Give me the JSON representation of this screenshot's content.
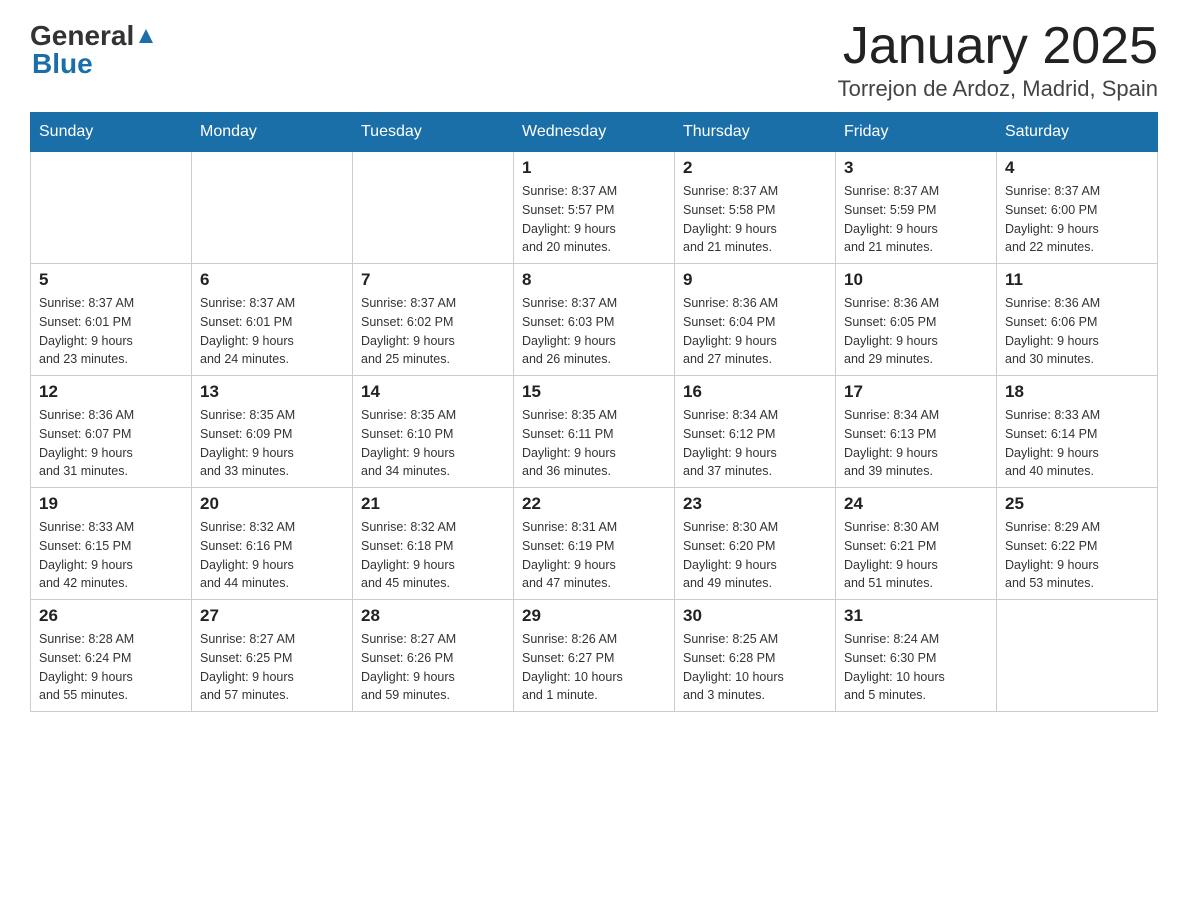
{
  "header": {
    "logo_general": "General",
    "logo_blue": "Blue",
    "month_title": "January 2025",
    "location": "Torrejon de Ardoz, Madrid, Spain"
  },
  "weekdays": [
    "Sunday",
    "Monday",
    "Tuesday",
    "Wednesday",
    "Thursday",
    "Friday",
    "Saturday"
  ],
  "weeks": [
    [
      {
        "day": "",
        "info": ""
      },
      {
        "day": "",
        "info": ""
      },
      {
        "day": "",
        "info": ""
      },
      {
        "day": "1",
        "info": "Sunrise: 8:37 AM\nSunset: 5:57 PM\nDaylight: 9 hours\nand 20 minutes."
      },
      {
        "day": "2",
        "info": "Sunrise: 8:37 AM\nSunset: 5:58 PM\nDaylight: 9 hours\nand 21 minutes."
      },
      {
        "day": "3",
        "info": "Sunrise: 8:37 AM\nSunset: 5:59 PM\nDaylight: 9 hours\nand 21 minutes."
      },
      {
        "day": "4",
        "info": "Sunrise: 8:37 AM\nSunset: 6:00 PM\nDaylight: 9 hours\nand 22 minutes."
      }
    ],
    [
      {
        "day": "5",
        "info": "Sunrise: 8:37 AM\nSunset: 6:01 PM\nDaylight: 9 hours\nand 23 minutes."
      },
      {
        "day": "6",
        "info": "Sunrise: 8:37 AM\nSunset: 6:01 PM\nDaylight: 9 hours\nand 24 minutes."
      },
      {
        "day": "7",
        "info": "Sunrise: 8:37 AM\nSunset: 6:02 PM\nDaylight: 9 hours\nand 25 minutes."
      },
      {
        "day": "8",
        "info": "Sunrise: 8:37 AM\nSunset: 6:03 PM\nDaylight: 9 hours\nand 26 minutes."
      },
      {
        "day": "9",
        "info": "Sunrise: 8:36 AM\nSunset: 6:04 PM\nDaylight: 9 hours\nand 27 minutes."
      },
      {
        "day": "10",
        "info": "Sunrise: 8:36 AM\nSunset: 6:05 PM\nDaylight: 9 hours\nand 29 minutes."
      },
      {
        "day": "11",
        "info": "Sunrise: 8:36 AM\nSunset: 6:06 PM\nDaylight: 9 hours\nand 30 minutes."
      }
    ],
    [
      {
        "day": "12",
        "info": "Sunrise: 8:36 AM\nSunset: 6:07 PM\nDaylight: 9 hours\nand 31 minutes."
      },
      {
        "day": "13",
        "info": "Sunrise: 8:35 AM\nSunset: 6:09 PM\nDaylight: 9 hours\nand 33 minutes."
      },
      {
        "day": "14",
        "info": "Sunrise: 8:35 AM\nSunset: 6:10 PM\nDaylight: 9 hours\nand 34 minutes."
      },
      {
        "day": "15",
        "info": "Sunrise: 8:35 AM\nSunset: 6:11 PM\nDaylight: 9 hours\nand 36 minutes."
      },
      {
        "day": "16",
        "info": "Sunrise: 8:34 AM\nSunset: 6:12 PM\nDaylight: 9 hours\nand 37 minutes."
      },
      {
        "day": "17",
        "info": "Sunrise: 8:34 AM\nSunset: 6:13 PM\nDaylight: 9 hours\nand 39 minutes."
      },
      {
        "day": "18",
        "info": "Sunrise: 8:33 AM\nSunset: 6:14 PM\nDaylight: 9 hours\nand 40 minutes."
      }
    ],
    [
      {
        "day": "19",
        "info": "Sunrise: 8:33 AM\nSunset: 6:15 PM\nDaylight: 9 hours\nand 42 minutes."
      },
      {
        "day": "20",
        "info": "Sunrise: 8:32 AM\nSunset: 6:16 PM\nDaylight: 9 hours\nand 44 minutes."
      },
      {
        "day": "21",
        "info": "Sunrise: 8:32 AM\nSunset: 6:18 PM\nDaylight: 9 hours\nand 45 minutes."
      },
      {
        "day": "22",
        "info": "Sunrise: 8:31 AM\nSunset: 6:19 PM\nDaylight: 9 hours\nand 47 minutes."
      },
      {
        "day": "23",
        "info": "Sunrise: 8:30 AM\nSunset: 6:20 PM\nDaylight: 9 hours\nand 49 minutes."
      },
      {
        "day": "24",
        "info": "Sunrise: 8:30 AM\nSunset: 6:21 PM\nDaylight: 9 hours\nand 51 minutes."
      },
      {
        "day": "25",
        "info": "Sunrise: 8:29 AM\nSunset: 6:22 PM\nDaylight: 9 hours\nand 53 minutes."
      }
    ],
    [
      {
        "day": "26",
        "info": "Sunrise: 8:28 AM\nSunset: 6:24 PM\nDaylight: 9 hours\nand 55 minutes."
      },
      {
        "day": "27",
        "info": "Sunrise: 8:27 AM\nSunset: 6:25 PM\nDaylight: 9 hours\nand 57 minutes."
      },
      {
        "day": "28",
        "info": "Sunrise: 8:27 AM\nSunset: 6:26 PM\nDaylight: 9 hours\nand 59 minutes."
      },
      {
        "day": "29",
        "info": "Sunrise: 8:26 AM\nSunset: 6:27 PM\nDaylight: 10 hours\nand 1 minute."
      },
      {
        "day": "30",
        "info": "Sunrise: 8:25 AM\nSunset: 6:28 PM\nDaylight: 10 hours\nand 3 minutes."
      },
      {
        "day": "31",
        "info": "Sunrise: 8:24 AM\nSunset: 6:30 PM\nDaylight: 10 hours\nand 5 minutes."
      },
      {
        "day": "",
        "info": ""
      }
    ]
  ]
}
